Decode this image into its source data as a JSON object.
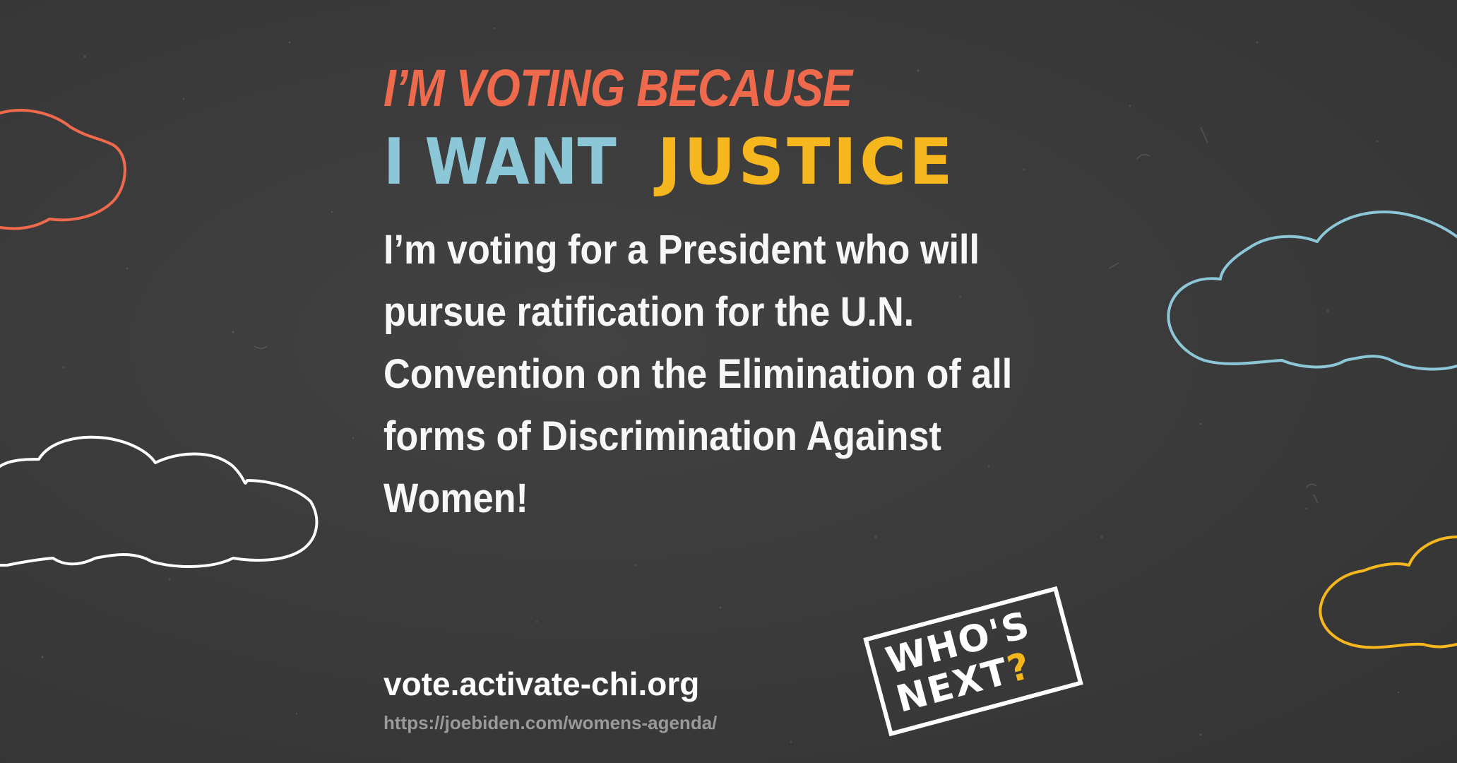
{
  "kicker": "I’M VOTING BECAUSE",
  "headline": {
    "part_a": "I WANT",
    "part_b": "JUSTICE"
  },
  "body": "I’m voting for a President who will pursue ratification for the U.N. Convention on the Elimination of all forms of Discrimination Against Women!",
  "footer": {
    "site": "vote.activate-chi.org",
    "source": "https://joebiden.com/womens-agenda/"
  },
  "stamp": {
    "line1": "WHO'S",
    "line2": "NEXT",
    "mark": "?"
  },
  "colors": {
    "background": "#3a3a3a",
    "kicker": "#ef6a4d",
    "headline_a": "#8cc7d8",
    "headline_b": "#f6b61d",
    "text": "#ffffff",
    "cloud_orange": "#ef6a4d",
    "cloud_white": "#ffffff",
    "cloud_blue": "#8cc7d8",
    "cloud_yellow": "#f6b61d"
  },
  "decorations": [
    "cloud-outline-orange",
    "cloud-outline-white",
    "cloud-outline-blue",
    "cloud-outline-yellow"
  ]
}
